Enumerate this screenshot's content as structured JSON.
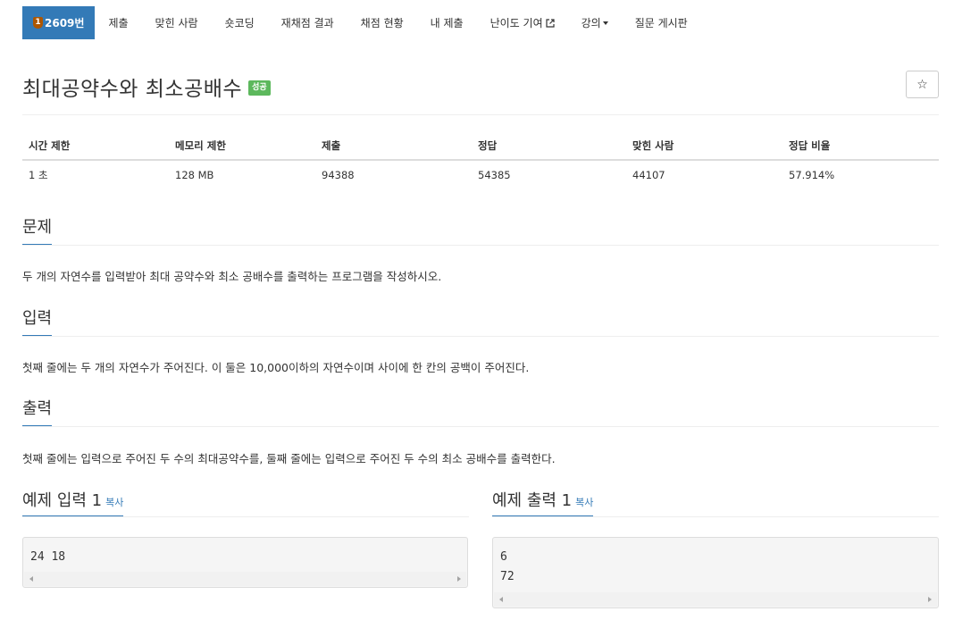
{
  "nav": {
    "problem": {
      "tier": "1",
      "label": "2609번"
    },
    "items": [
      "제출",
      "맞힌 사람",
      "숏코딩",
      "재채점 결과",
      "채점 현황",
      "내 제출",
      "난이도 기여",
      "강의",
      "질문 게시판"
    ]
  },
  "problem": {
    "title": "최대공약수와 최소공배수",
    "status_badge": "성공",
    "star": "☆"
  },
  "info": {
    "headers": [
      "시간 제한",
      "메모리 제한",
      "제출",
      "정답",
      "맞힌 사람",
      "정답 비율"
    ],
    "values": [
      "1 초",
      "128 MB",
      "94388",
      "54385",
      "44107",
      "57.914%"
    ]
  },
  "sections": {
    "description": {
      "heading": "문제",
      "text": "두 개의 자연수를 입력받아 최대 공약수와 최소 공배수를 출력하는 프로그램을 작성하시오."
    },
    "input": {
      "heading": "입력",
      "text": "첫째 줄에는 두 개의 자연수가 주어진다. 이 둘은 10,000이하의 자연수이며 사이에 한 칸의 공백이 주어진다."
    },
    "output": {
      "heading": "출력",
      "text": "첫째 줄에는 입력으로 주어진 두 수의 최대공약수를, 둘째 줄에는 입력으로 주어진 두 수의 최소 공배수를 출력한다."
    }
  },
  "samples": {
    "input": {
      "heading": "예제 입력 1",
      "copy": "복사",
      "content": "24 18"
    },
    "output": {
      "heading": "예제 출력 1",
      "copy": "복사",
      "content": "6\n72"
    }
  },
  "colors": {
    "primary": "#337ab7",
    "success": "#5cb85c",
    "tier_bronze": "#ad5600"
  }
}
